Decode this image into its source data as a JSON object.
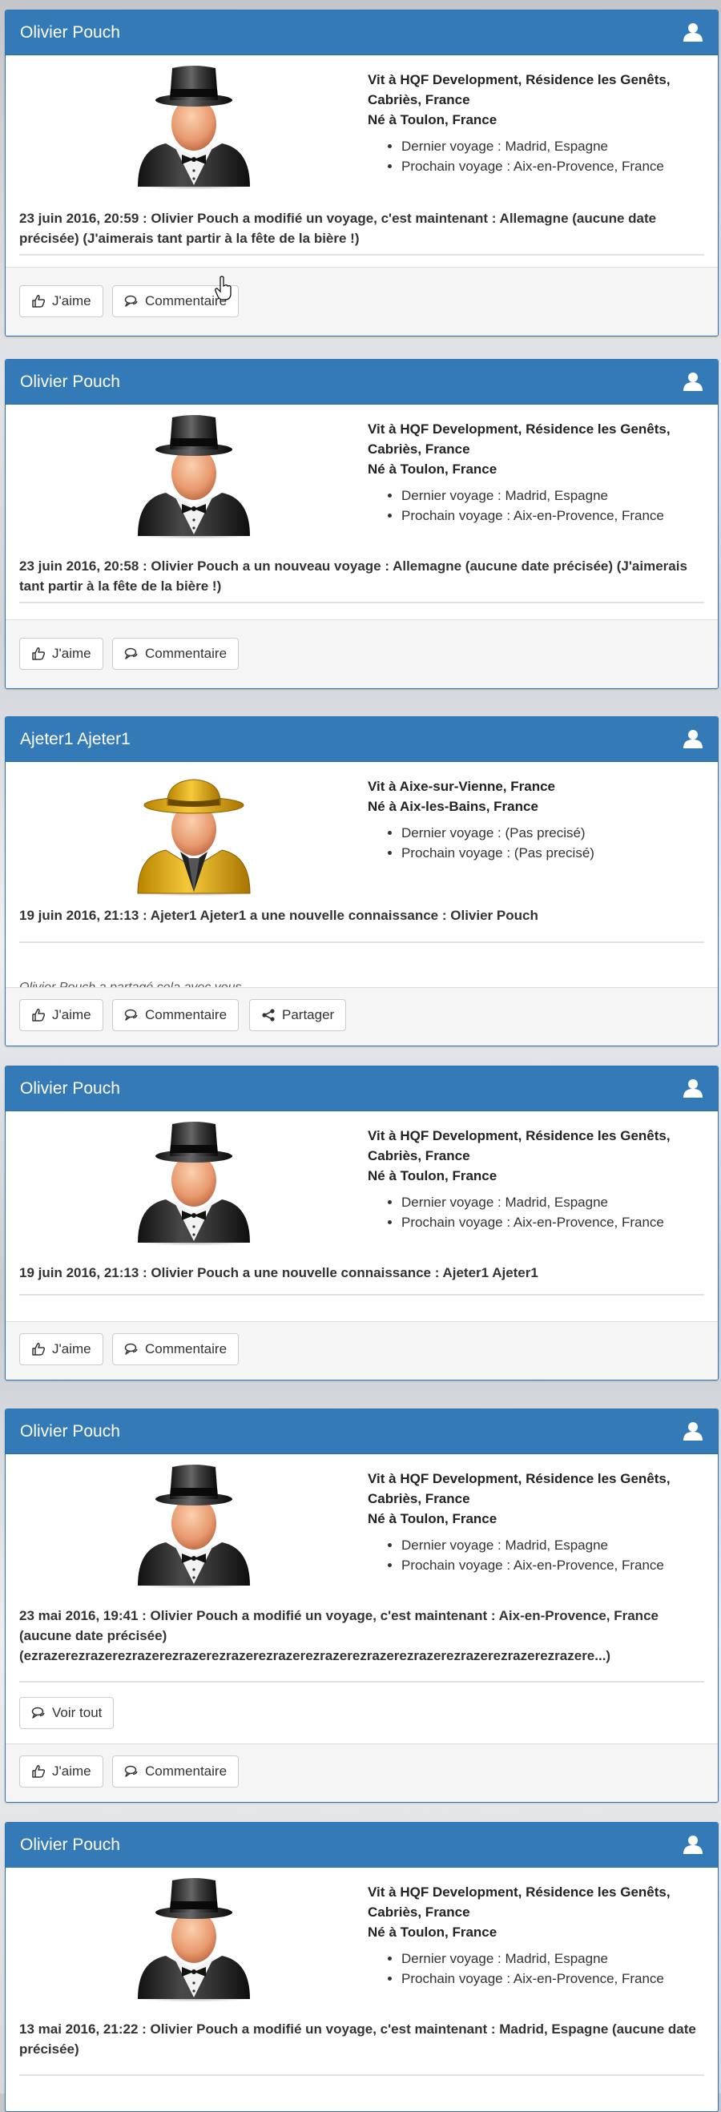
{
  "icons": {
    "user": "user-icon",
    "like": "thumbs-up-icon",
    "comment": "comment-icon",
    "share": "share-icon"
  },
  "colors": {
    "header": "#337ab7",
    "footer": "#f5f5f5"
  },
  "cards": [
    {
      "name": "Olivier Pouch",
      "avatar": "top-hat",
      "lives": "Vit à HQF Development, Résidence les Genêts, Cabriès, France",
      "born": "Né à Toulon, France",
      "last_trip": "Dernier voyage : Madrid, Espagne",
      "next_trip": "Prochain voyage : Aix-en-Provence, France",
      "event": "23 juin 2016, 20:59 : Olivier Pouch a modifié un voyage, c'est maintenant : Allemagne (aucune date précisée) (J'aimerais tant partir à la fête de la bière !)",
      "like": "J'aime",
      "comment": "Commentaire"
    },
    {
      "name": "Olivier Pouch",
      "avatar": "top-hat",
      "lives": "Vit à HQF Development, Résidence les Genêts, Cabriès, France",
      "born": "Né à Toulon, France",
      "last_trip": "Dernier voyage : Madrid, Espagne",
      "next_trip": "Prochain voyage : Aix-en-Provence, France",
      "event": "23 juin 2016, 20:58 : Olivier Pouch a un nouveau voyage : Allemagne (aucune date précisée) (J'aimerais tant partir à la fête de la bière !)",
      "like": "J'aime",
      "comment": "Commentaire"
    },
    {
      "name": "Ajeter1 Ajeter1",
      "avatar": "detective",
      "lives": "Vit à Aixe-sur-Vienne, France",
      "born": "Né à Aix-les-Bains, France",
      "last_trip": "Dernier voyage : (Pas precisé)",
      "next_trip": "Prochain voyage : (Pas precisé)",
      "event": "19 juin 2016, 21:13 : Ajeter1 Ajeter1 a une nouvelle connaissance : Olivier Pouch",
      "shared": "Olivier Pouch a partagé cela avec vous",
      "like": "J'aime",
      "comment": "Commentaire",
      "share": "Partager"
    },
    {
      "name": "Olivier Pouch",
      "avatar": "top-hat",
      "lives": "Vit à HQF Development, Résidence les Genêts, Cabriès, France",
      "born": "Né à Toulon, France",
      "last_trip": "Dernier voyage : Madrid, Espagne",
      "next_trip": "Prochain voyage : Aix-en-Provence, France",
      "event": "19 juin 2016, 21:13 : Olivier Pouch a une nouvelle connaissance : Ajeter1 Ajeter1",
      "like": "J'aime",
      "comment": "Commentaire"
    },
    {
      "name": "Olivier Pouch",
      "avatar": "top-hat",
      "lives": "Vit à HQF Development, Résidence les Genêts, Cabriès, France",
      "born": "Né à Toulon, France",
      "last_trip": "Dernier voyage : Madrid, Espagne",
      "next_trip": "Prochain voyage : Aix-en-Provence, France",
      "event": "23 mai 2016, 19:41 : Olivier Pouch a modifié un voyage, c'est maintenant : Aix-en-Provence, France (aucune date précisée) (ezrazerezrazerezrazerezrazerezrazerezrazerezrazerezrazerezrazerezrazerezrazerezrazere...)",
      "see_all": "Voir tout",
      "like": "J'aime",
      "comment": "Commentaire"
    },
    {
      "name": "Olivier Pouch",
      "avatar": "top-hat",
      "lives": "Vit à HQF Development, Résidence les Genêts, Cabriès, France",
      "born": "Né à Toulon, France",
      "last_trip": "Dernier voyage : Madrid, Espagne",
      "next_trip": "Prochain voyage : Aix-en-Provence, France",
      "event": "13 mai 2016, 21:22 : Olivier Pouch a modifié un voyage, c'est maintenant : Madrid, Espagne (aucune date précisée)"
    }
  ]
}
